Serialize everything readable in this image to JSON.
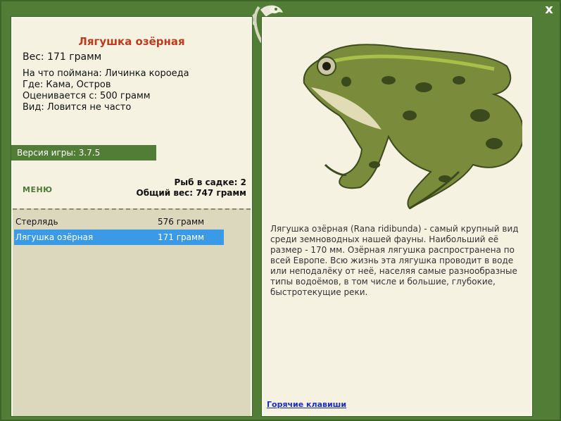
{
  "fish": {
    "title": "Лягушка озёрная",
    "weight": "Вес: 171 грамм",
    "bait": "На что поймана: Личинка короеда",
    "place": "Где: Кама, Остров",
    "valued": "Оценивается с: 500 грамм",
    "rarity": "Вид: Ловится не часто"
  },
  "version": "Версия игры: 3.7.5",
  "menu_label": "МЕНЮ",
  "stats": {
    "count": "Рыб в садке: 2",
    "total": "Общий вес: 747 грамм"
  },
  "catch_list": [
    {
      "name": "Стерлядь",
      "weight": "576 грамм"
    },
    {
      "name": "Лягушка озёрная",
      "weight": "171 грамм"
    }
  ],
  "description": "Лягушка озёрная (Rana ridibunda) - самый крупный вид среди земноводных нашей фауны. Наибольший её размер - 170 мм. Озёрная лягушка распространена по всей Европе. Всю жизнь эта лягушка проводит в воде или неподалёку от неё, населяя самые разнообразные типы водоёмов, в том числе и большие, глубокие, быстротекущие реки.",
  "hotkeys_label": "Горячие клавиши",
  "close_label": "x",
  "colors": {
    "frame_green": "#527d36",
    "panel_bg": "#f5f2e2",
    "title_red": "#c0391d",
    "selected_blue": "#3b9ae8",
    "link_blue": "#1b2cbf"
  },
  "icons": [
    "close-icon",
    "frog-emblem-icon",
    "frog-photo"
  ]
}
